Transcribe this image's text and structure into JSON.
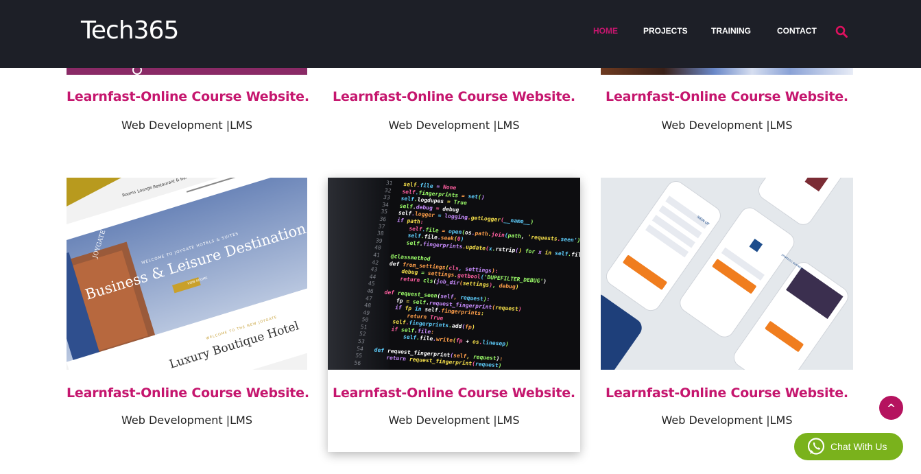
{
  "header": {
    "logo": "Tech365",
    "nav": [
      {
        "label": "HOME",
        "active": true
      },
      {
        "label": "PROJECTS",
        "active": false
      },
      {
        "label": "TRAINING",
        "active": false
      },
      {
        "label": "CONTACT",
        "active": false
      }
    ],
    "search_icon": "search-icon"
  },
  "colors": {
    "accent": "#c5166e",
    "header_bg": "#1d1f27",
    "chat_green": "#7ab21c"
  },
  "projects_row1": [
    {
      "title": "Learnfast-Online Course Website.",
      "category": "Web Development |LMS"
    },
    {
      "title": "Learnfast-Online Course Website.",
      "category": "Web Development |LMS"
    },
    {
      "title": "Learnfast-Online Course Website.",
      "category": "Web Development |LMS"
    }
  ],
  "projects_row2": [
    {
      "title": "Learnfast-Online Course Website.",
      "category": "Web Development |LMS",
      "thumb": {
        "nav_items": [
          "Rooms",
          "Lounge",
          "Restaurant & Bar"
        ],
        "brand": "JOYGATE",
        "welcome": "WELCOME TO JOYGATE HOTELS & SUITES",
        "headline": "Business & Leisure Destination",
        "button": "VIEW ROOMS",
        "sub_welcome": "WELCOME TO THE NEW JOYGATE",
        "sub_headline": "Luxury Boutique Hotel"
      }
    },
    {
      "title": "Learnfast-Online Course Website.",
      "category": "Web Development |LMS",
      "thumb": {
        "line_numbers": [
          "31",
          "32",
          "33",
          "34",
          "35",
          "36",
          "37",
          "38",
          "39",
          "40",
          "41",
          "42",
          "43",
          "44",
          "45",
          "46",
          "47",
          "48",
          "49",
          "50",
          "51",
          "52",
          "53",
          "54",
          "55",
          "56"
        ],
        "code_lines": [
          "self.file = None",
          "self.fingerprints = set()",
          "self.logdupes = True",
          "self.debug = debug",
          "self.logger = logging.getLogger(__name__)",
          "if path:",
          "    self.file = open(os.path.join(path, 'requests.seen'), 'a+')",
          "    self.file.seek(0)",
          "    self.fingerprints.update(x.rstrip() for x in self.file)",
          "",
          "@classmethod",
          "def from_settings(cls, settings):",
          "    debug = settings.getbool('DUPEFILTER_DEBUG')",
          "    return cls(job_dir(settings), debug)",
          "",
          "def request_seen(self, request):",
          "    fp = self.request_fingerprint(request)",
          "    if fp in self.fingerprints:",
          "        return True",
          "    self.fingerprints.add(fp)",
          "    if self.file:",
          "        self.file.write(fp + os.linesep)",
          "",
          "def request_fingerprint(self, request):",
          "    return request_fingerprint(request)",
          ""
        ]
      }
    },
    {
      "title": "Learnfast-Online Course Website.",
      "category": "Web Development |LMS",
      "thumb": {
        "signup": "SIGN UP",
        "brand": "STRATEGIC BUSINESS"
      }
    }
  ],
  "back_to_top": "^",
  "chat": {
    "label": "Chat With Us"
  }
}
